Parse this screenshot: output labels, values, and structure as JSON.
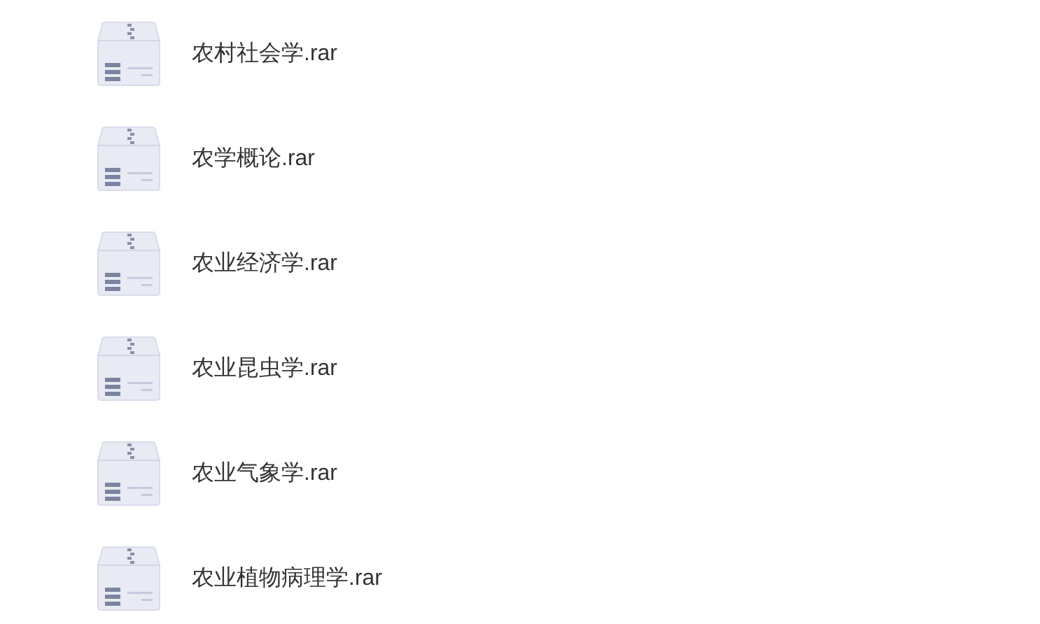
{
  "files": [
    {
      "name": "农村社会学.rar"
    },
    {
      "name": "农学概论.rar"
    },
    {
      "name": "农业经济学.rar"
    },
    {
      "name": "农业昆虫学.rar"
    },
    {
      "name": "农业气象学.rar"
    },
    {
      "name": "农业植物病理学.rar"
    }
  ]
}
